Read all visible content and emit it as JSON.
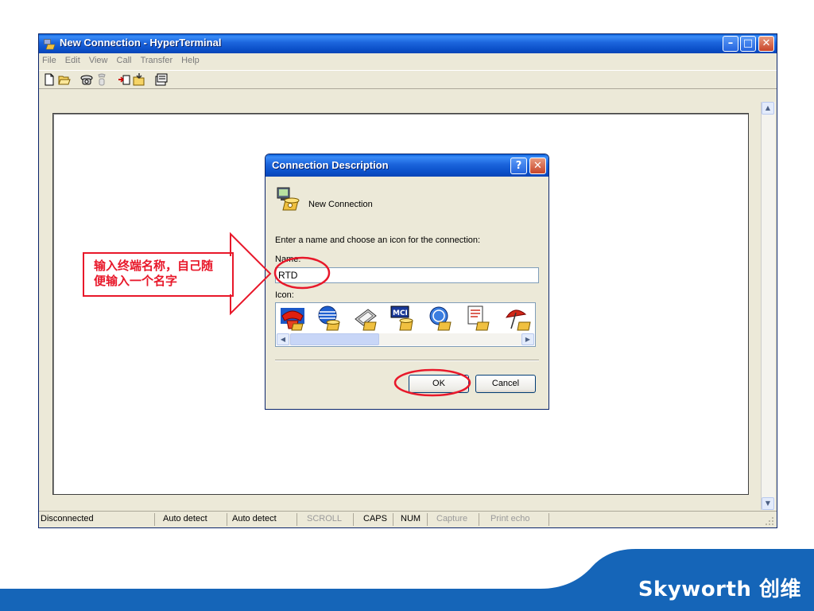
{
  "window": {
    "title": "New Connection - HyperTerminal",
    "controls": {
      "minimize": "–",
      "maximize": "□",
      "close": "✕"
    }
  },
  "menu": [
    "File",
    "Edit",
    "View",
    "Call",
    "Transfer",
    "Help"
  ],
  "toolbar_icons": [
    "new-document-icon",
    "open-folder-icon",
    "connect-phone-icon",
    "disconnect-phone-icon",
    "send-icon",
    "receive-icon",
    "properties-icon"
  ],
  "dialog": {
    "title": "Connection Description",
    "help": "?",
    "close": "✕",
    "connection_name": "New Connection",
    "instruction": "Enter a name and choose an icon for the connection:",
    "name_label": "Name:",
    "name_value": "RTD",
    "icon_label": "Icon:",
    "icons": [
      "red-phone-icon",
      "globe-phone-icon",
      "fax-phone-icon",
      "mci-phone-icon",
      "ge-phone-icon",
      "document-phone-icon",
      "umbrella-phone-icon"
    ],
    "ok": "OK",
    "cancel": "Cancel"
  },
  "statusbar": {
    "items": [
      "Disconnected",
      "Auto detect",
      "Auto detect",
      "SCROLL",
      "CAPS",
      "NUM",
      "Capture",
      "Print echo"
    ]
  },
  "annotation": {
    "line1": "输入终端名称，自己随",
    "line2": "便输入一个名字"
  },
  "brand": "Skyworth 创维",
  "colors": {
    "annotation": "#e8182a",
    "footer": "#1565b8",
    "title_bar": "#0a4fc8"
  }
}
